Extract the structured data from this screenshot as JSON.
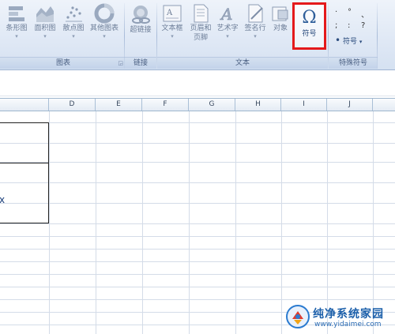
{
  "ribbon": {
    "charts_group": {
      "label": "图表",
      "buttons": [
        {
          "label": "条形图",
          "icon": "bar-chart-icon"
        },
        {
          "label": "面积图",
          "icon": "area-chart-icon"
        },
        {
          "label": "散点图",
          "icon": "scatter-chart-icon"
        },
        {
          "label": "其他图表",
          "icon": "other-charts-icon"
        }
      ]
    },
    "links_group": {
      "label": "链接",
      "buttons": [
        {
          "label": "超链接",
          "icon": "hyperlink-icon"
        }
      ]
    },
    "text_group": {
      "label": "文本",
      "buttons": [
        {
          "label": "文本框",
          "icon": "textbox-icon"
        },
        {
          "label": "页眉和",
          "label2": "页脚",
          "icon": "header-footer-icon"
        },
        {
          "label": "艺术字",
          "icon": "wordart-icon"
        },
        {
          "label": "签名行",
          "icon": "signature-line-icon"
        },
        {
          "label": "对象",
          "icon": "object-icon"
        },
        {
          "label": "符号",
          "icon": "omega-symbol-icon",
          "glyph": "Ω"
        }
      ]
    },
    "special_group": {
      "label": "特殊符号",
      "chars": [
        "·",
        "°",
        "、",
        ";",
        ":",
        "?",
        "•"
      ],
      "button_label": "符号"
    }
  },
  "sheet": {
    "columns": [
      "D",
      "E",
      "F",
      "G",
      "H",
      "I",
      "J"
    ],
    "cell_fragment": "x"
  },
  "watermark": {
    "title": "纯净系统家园",
    "url": "www.yidaimei.com"
  },
  "colors": {
    "highlight": "#e4191b",
    "ribbon_bg": "#dfe8f5",
    "gridline": "#d4dce8"
  }
}
